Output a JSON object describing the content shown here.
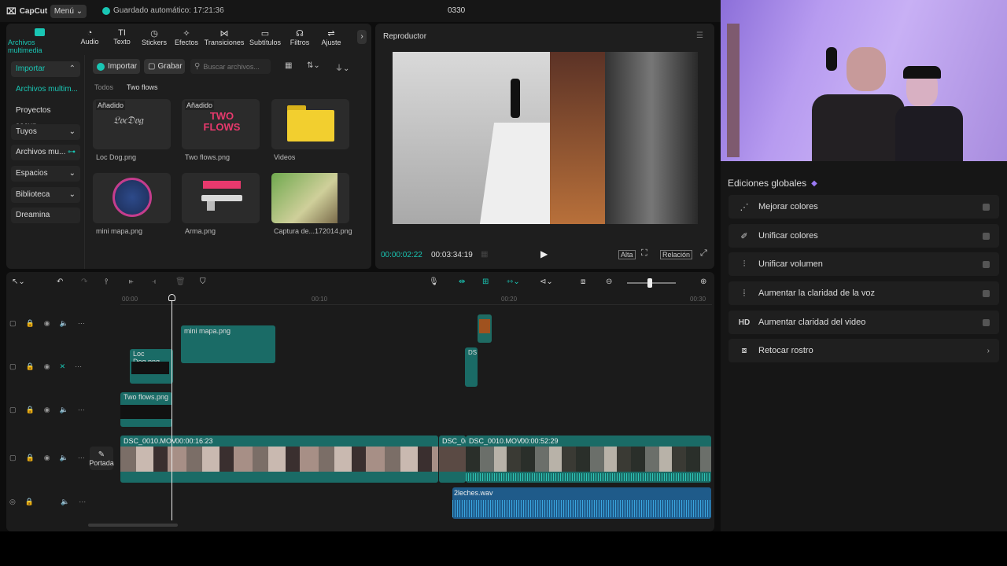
{
  "topbar": {
    "logo": "CapCut",
    "menu": "Menú",
    "autosave": "Guardado automático: 17:21:36",
    "project": "0330"
  },
  "toolbar": {
    "items": [
      {
        "label": "Archivos multimedia",
        "icon": "media-icon"
      },
      {
        "label": "Audio",
        "icon": "audio-icon"
      },
      {
        "label": "Texto",
        "icon": "text-icon"
      },
      {
        "label": "Stickers",
        "icon": "sticker-icon"
      },
      {
        "label": "Efectos",
        "icon": "effects-icon"
      },
      {
        "label": "Transiciones",
        "icon": "transitions-icon"
      },
      {
        "label": "Subtítulos",
        "icon": "subtitles-icon"
      },
      {
        "label": "Filtros",
        "icon": "filters-icon"
      },
      {
        "label": "Ajuste",
        "icon": "adjust-icon"
      }
    ]
  },
  "sidebar": {
    "items": [
      {
        "label": "Importar"
      },
      {
        "label": "Archivos multim..."
      },
      {
        "label": "Proyectos secun..."
      },
      {
        "label": "Tuyos"
      },
      {
        "label": "Archivos mu..."
      },
      {
        "label": "Espacios"
      },
      {
        "label": "Biblioteca"
      },
      {
        "label": "Dreamina"
      }
    ]
  },
  "media": {
    "import_btn": "Importar",
    "record_btn": "Grabar",
    "search_placeholder": "Buscar archivos...",
    "filter_all": "Todos",
    "filter_active": "Two flows",
    "badge": "Añadido",
    "items": [
      {
        "name": "Loc Dog.png",
        "added": "Añadido"
      },
      {
        "name": "Two flows.png",
        "added": "Añadido"
      },
      {
        "name": "Videos"
      },
      {
        "name": "mini mapa.png"
      },
      {
        "name": "Arma.png"
      },
      {
        "name": "Captura de...172014.png"
      }
    ]
  },
  "player": {
    "title": "Reproductor",
    "current": "00:00:02:22",
    "total": "00:03:34:19",
    "quality": "Alta",
    "ratio": "Relación"
  },
  "timeline": {
    "ruler": [
      "00:00",
      "00:10",
      "00:20",
      "00:30"
    ],
    "cover": "Portada",
    "clips": {
      "minimapa": "mini mapa.png",
      "locdog": "Loc Dog.png",
      "twoflows": "Two flows.png",
      "main1_name": "DSC_0010.MOV",
      "main1_dur": "00:00:16:23",
      "main2_name": "DSC_0(",
      "main3_name": "DSC_0010.MOV",
      "main3_dur": "00:00:52:29",
      "small": "DS",
      "audio": "2leches.wav"
    }
  },
  "global": {
    "title": "Ediciones globales",
    "items": [
      {
        "label": "Mejorar colores",
        "icon": "wand-icon"
      },
      {
        "label": "Unificar colores",
        "icon": "palette-icon"
      },
      {
        "label": "Unificar volumen",
        "icon": "sliders-icon"
      },
      {
        "label": "Aumentar la claridad de la voz",
        "icon": "waveform-icon"
      },
      {
        "label": "Aumentar claridad del video",
        "icon": "hd-icon"
      },
      {
        "label": "Retocar rostro",
        "icon": "face-icon"
      }
    ]
  },
  "colors": {
    "accent": "#19c6b4",
    "clip": "#1a6b66",
    "audio": "#1f5b8a"
  }
}
